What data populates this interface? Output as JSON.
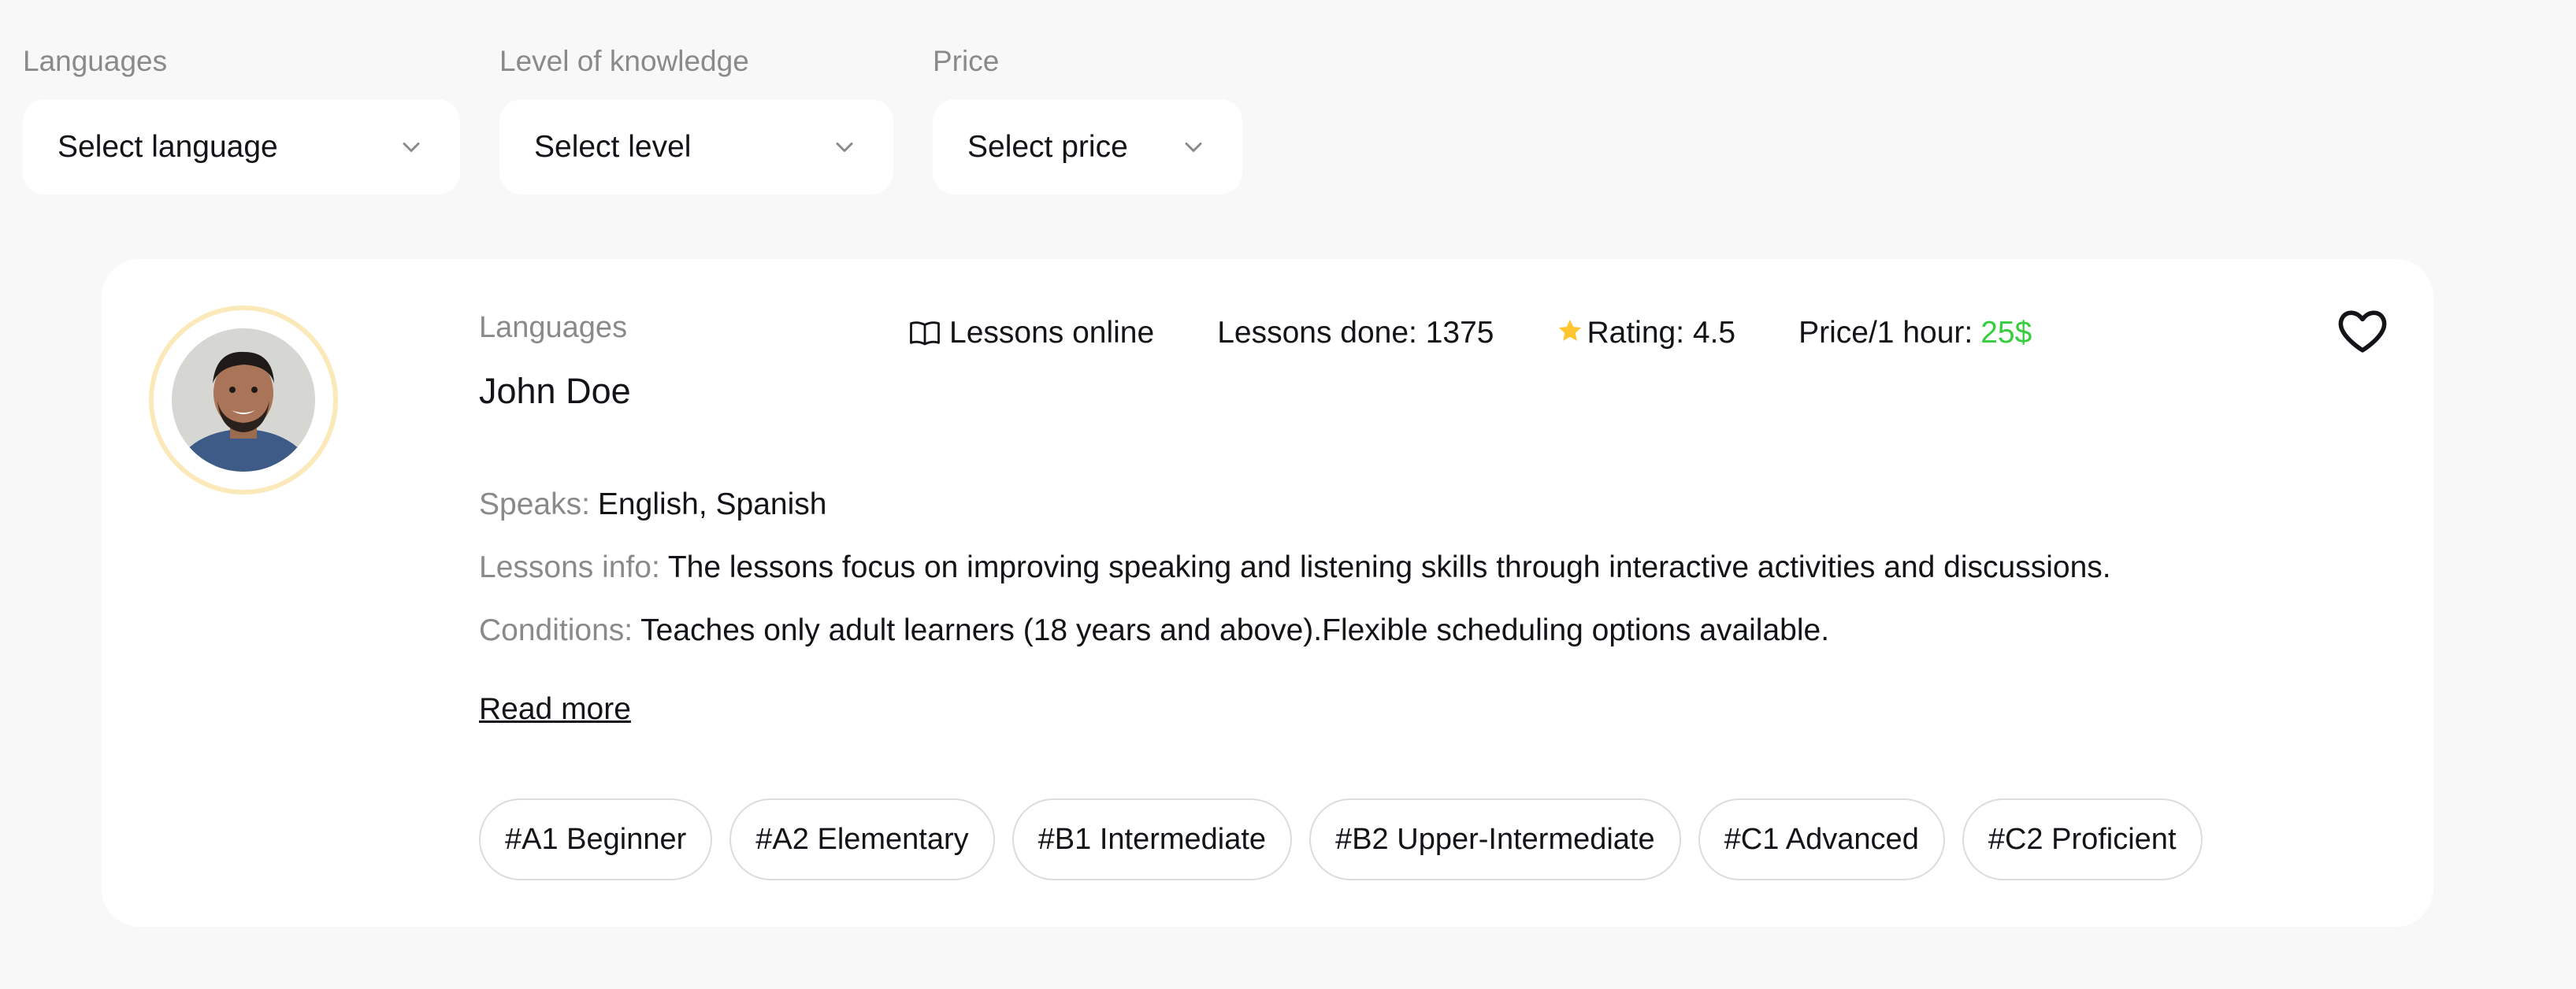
{
  "filters": {
    "language": {
      "label": "Languages",
      "placeholder": "Select language"
    },
    "level": {
      "label": "Level of knowledge",
      "placeholder": "Select level"
    },
    "price": {
      "label": "Price",
      "placeholder": "Select price"
    }
  },
  "teacher": {
    "kicker": "Languages",
    "name": "John Doe",
    "stats": {
      "lessons_online": "Lessons online",
      "lessons_done": "Lessons done: 1375",
      "rating": "Rating: 4.5",
      "price_label": "Price/1 hour:",
      "price_value": "25$"
    },
    "speaks": {
      "label": "Speaks:",
      "value": "English, Spanish"
    },
    "lessons_info": {
      "label": "Lessons info:",
      "value": "The lessons focus on improving speaking and listening skills through interactive activities and discussions."
    },
    "conditions": {
      "label": "Conditions:",
      "value": "Teaches only adult learners (18 years and above).Flexible scheduling options available."
    },
    "read_more": "Read more",
    "levels": [
      "#A1 Beginner",
      "#A2 Elementary",
      "#B1 Intermediate",
      "#B2 Upper-Intermediate",
      "#C1 Advanced",
      "#C2 Proficient"
    ]
  },
  "icons": {
    "chevron": "chevron-down-icon",
    "book": "book-icon",
    "star": "star-icon",
    "heart": "heart-icon",
    "avatar": "avatar"
  },
  "colors": {
    "background": "#f8f8f8",
    "card": "#ffffff",
    "muted": "#8a8a89",
    "price": "#38cd3e",
    "star": "#ffc531",
    "avatar_ring": "#fbe9ba"
  }
}
